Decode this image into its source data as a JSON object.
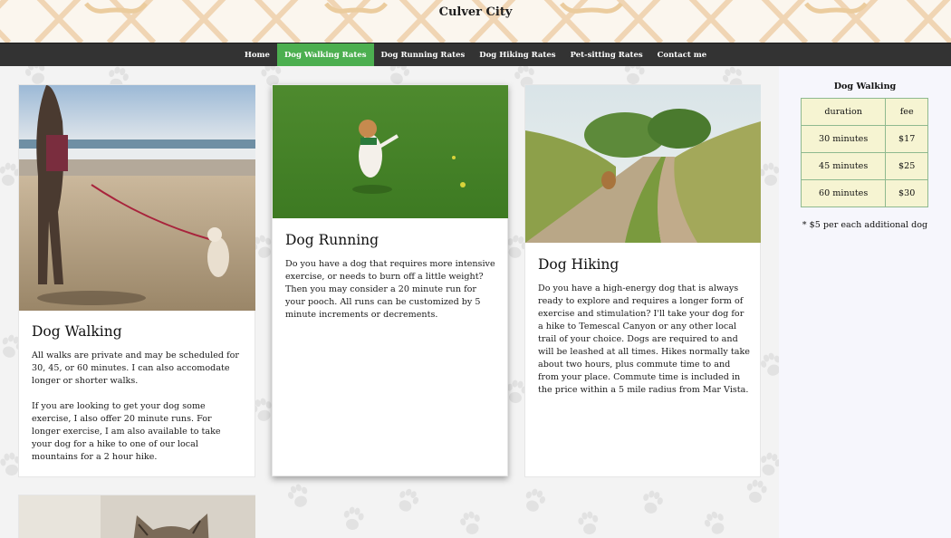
{
  "site": {
    "title": "Culver City"
  },
  "nav": {
    "items": [
      {
        "label": "Home",
        "active": false
      },
      {
        "label": "Dog Walking Rates",
        "active": true
      },
      {
        "label": "Dog Running Rates",
        "active": false
      },
      {
        "label": "Dog Hiking Rates",
        "active": false
      },
      {
        "label": "Pet-sitting Rates",
        "active": false
      },
      {
        "label": "Contact me",
        "active": false
      }
    ]
  },
  "cards": {
    "walking": {
      "title": "Dog Walking",
      "paragraphs": [
        "All walks are private and may be scheduled for 30, 45, or 60 minutes. I can also accomodate longer or shorter walks.",
        "If you are looking to get your dog some exercise, I also offer 20 minute runs. For longer exercise, I am also available to take your dog for a hike to one of our local mountains for a 2 hour hike."
      ]
    },
    "running": {
      "title": "Dog Running",
      "text": "Do you have a dog that requires more intensive exercise, or needs to burn off a little weight? Then you may consider a 20 minute run for your pooch. All runs can be customized by 5 minute increments or decrements."
    },
    "hiking": {
      "title": "Dog Hiking",
      "text": "Do you have a high-energy dog that is always ready to explore and requires a longer form of exercise and stimulation? I'll take your dog for a hike to Temescal Canyon or any other local trail of your choice. Dogs are required to and will be leashed at all times. Hikes normally take about two hours, plus commute time to and from your place. Commute time is included in the price within a 5 mile radius from Mar Vista."
    }
  },
  "rates": {
    "caption": "Dog Walking",
    "headers": [
      "duration",
      "fee"
    ],
    "rows": [
      [
        "30 minutes",
        "$17"
      ],
      [
        "45 minutes",
        "$25"
      ],
      [
        "60 minutes",
        "$30"
      ]
    ],
    "note": "* $5 per each additional dog"
  },
  "colors": {
    "nav_bg": "#333333",
    "nav_active": "#4caf50",
    "table_bg": "#f6f4d2",
    "table_border": "#8fb98f"
  }
}
